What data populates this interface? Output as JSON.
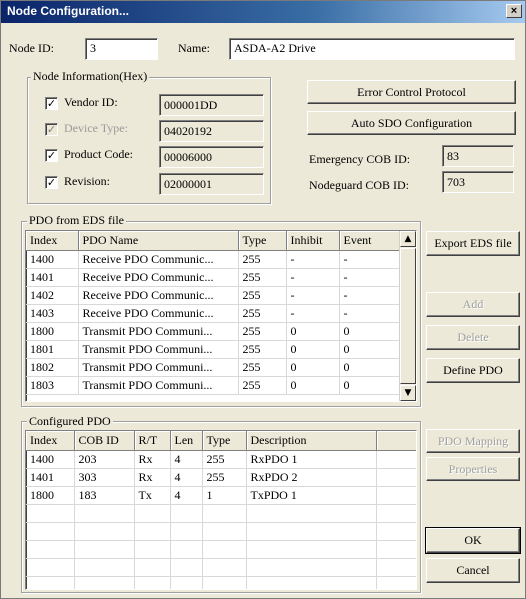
{
  "window": {
    "title": "Node Configuration...",
    "close_glyph": "×"
  },
  "node": {
    "id_label": "Node ID:",
    "id_value": "3",
    "name_label": "Name:",
    "name_value": "ASDA-A2 Drive"
  },
  "node_info": {
    "title": "Node Information(Hex)",
    "vendor_label": "Vendor ID:",
    "vendor_value": "000001DD",
    "vendor_checked": true,
    "device_label": "Device Type:",
    "device_value": "04020192",
    "device_checked": true,
    "product_label": "Product Code:",
    "product_value": "00006000",
    "product_checked": true,
    "revision_label": "Revision:",
    "revision_value": "02000001",
    "revision_checked": true
  },
  "buttons": {
    "error_control": "Error Control Protocol",
    "auto_sdo": "Auto SDO Configuration",
    "export_eds": "Export EDS file",
    "add": "Add",
    "delete": "Delete",
    "define_pdo": "Define PDO",
    "pdo_mapping": "PDO Mapping",
    "properties": "Properties",
    "ok": "OK",
    "cancel": "Cancel"
  },
  "cob": {
    "emergency_label": "Emergency COB ID:",
    "emergency_value": "83",
    "nodeguard_label": "Nodeguard COB ID:",
    "nodeguard_value": "703"
  },
  "eds": {
    "title": "PDO from EDS file",
    "columns": [
      "Index",
      "PDO Name",
      "Type",
      "Inhibit",
      "Event"
    ],
    "rows": [
      [
        "1400",
        "Receive PDO Communic...",
        "255",
        "-",
        "-"
      ],
      [
        "1401",
        "Receive PDO Communic...",
        "255",
        "-",
        "-"
      ],
      [
        "1402",
        "Receive PDO Communic...",
        "255",
        "-",
        "-"
      ],
      [
        "1403",
        "Receive PDO Communic...",
        "255",
        "-",
        "-"
      ],
      [
        "1800",
        "Transmit PDO Communi...",
        "255",
        "0",
        "0"
      ],
      [
        "1801",
        "Transmit PDO Communi...",
        "255",
        "0",
        "0"
      ],
      [
        "1802",
        "Transmit PDO Communi...",
        "255",
        "0",
        "0"
      ],
      [
        "1803",
        "Transmit PDO Communi...",
        "255",
        "0",
        "0"
      ]
    ]
  },
  "configured": {
    "title": "Configured PDO",
    "columns": [
      "Index",
      "COB ID",
      "R/T",
      "Len",
      "Type",
      "Description"
    ],
    "rows": [
      [
        "1400",
        "203",
        "Rx",
        "4",
        "255",
        "RxPDO 1"
      ],
      [
        "1401",
        "303",
        "Rx",
        "4",
        "255",
        "RxPDO 2"
      ],
      [
        "1800",
        "183",
        "Tx",
        "4",
        "1",
        "TxPDO 1"
      ]
    ],
    "empty_rows": 6
  },
  "icons": {
    "check": "✓",
    "scroll_up": "▲",
    "scroll_down": "▼"
  }
}
